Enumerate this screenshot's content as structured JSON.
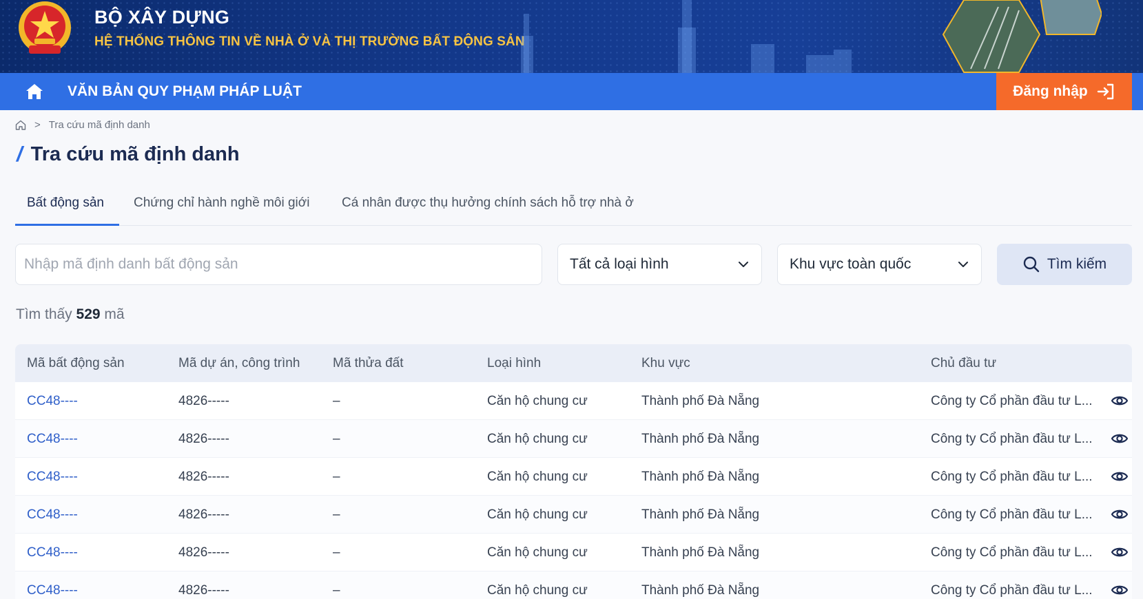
{
  "header": {
    "agency": "BỘ XÂY DỰNG",
    "system_name": "HỆ THỐNG THÔNG TIN VỀ NHÀ Ở VÀ THỊ TRƯỜNG BẤT ĐỘNG SẢN",
    "emblem_icon": "national-emblem-icon"
  },
  "nav": {
    "home_icon": "home-icon",
    "legal_docs": "VĂN BẢN QUY PHẠM PHÁP LUẬT",
    "login_label": "Đăng nhập",
    "login_icon": "login-arrow-icon"
  },
  "breadcrumb": {
    "home_icon": "home-icon",
    "separator": ">",
    "current": "Tra cứu mã định danh"
  },
  "page": {
    "title_slash": "/",
    "title": "Tra cứu mã định danh"
  },
  "tabs": [
    {
      "label": "Bất động sản",
      "active": true
    },
    {
      "label": "Chứng chỉ hành nghề môi giới",
      "active": false
    },
    {
      "label": "Cá nhân được thụ hưởng chính sách hỗ trợ nhà ở",
      "active": false
    }
  ],
  "search": {
    "placeholder": "Nhập mã định danh bất động sản",
    "value": "",
    "type_select": "Tất cả loại hình",
    "area_select": "Khu vực toàn quốc",
    "button_label": "Tìm kiếm"
  },
  "result": {
    "prefix": "Tìm thấy",
    "count": "529",
    "suffix": "mã"
  },
  "table": {
    "columns": [
      "Mã bất động sản",
      "Mã dự án, công trình",
      "Mã thửa đất",
      "Loại hình",
      "Khu vực",
      "Chủ đầu tư"
    ],
    "rows": [
      [
        "CC48----",
        "4826-----",
        "–",
        "Căn hộ chung cư",
        "Thành phố Đà Nẵng",
        "Công ty Cổ phần đầu tư L..."
      ],
      [
        "CC48----",
        "4826-----",
        "–",
        "Căn hộ chung cư",
        "Thành phố Đà Nẵng",
        "Công ty Cổ phần đầu tư L..."
      ],
      [
        "CC48----",
        "4826-----",
        "–",
        "Căn hộ chung cư",
        "Thành phố Đà Nẵng",
        "Công ty Cổ phần đầu tư L..."
      ],
      [
        "CC48----",
        "4826-----",
        "–",
        "Căn hộ chung cư",
        "Thành phố Đà Nẵng",
        "Công ty Cổ phần đầu tư L..."
      ],
      [
        "CC48----",
        "4826-----",
        "–",
        "Căn hộ chung cư",
        "Thành phố Đà Nẵng",
        "Công ty Cổ phần đầu tư L..."
      ],
      [
        "CC48----",
        "4826-----",
        "–",
        "Căn hộ chung cư",
        "Thành phố Đà Nẵng",
        "Công ty Cổ phần đầu tư L..."
      ]
    ],
    "row_action_icon": "eye-icon"
  },
  "colors": {
    "banner": "#13388a",
    "nav": "#2f6fe4",
    "login": "#f56a2a",
    "accent_yellow": "#f6c344",
    "link": "#2f5fc9"
  }
}
